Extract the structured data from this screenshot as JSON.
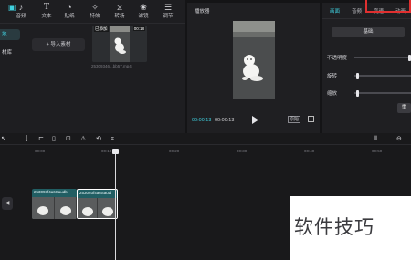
{
  "toolbar": {
    "items": [
      {
        "label": "",
        "icon": "media-icon",
        "active": true
      },
      {
        "label": "音频",
        "icon": "audio-icon"
      },
      {
        "label": "文本",
        "icon": "text-icon"
      },
      {
        "label": "贴纸",
        "icon": "sticker-icon"
      },
      {
        "label": "特效",
        "icon": "effects-icon"
      },
      {
        "label": "转场",
        "icon": "transition-icon"
      },
      {
        "label": "滤镜",
        "icon": "filter-icon"
      },
      {
        "label": "调节",
        "icon": "adjust-icon"
      }
    ]
  },
  "media_side": {
    "item1": "地",
    "item2": "材库"
  },
  "media": {
    "import_label": "导入素材",
    "clip": {
      "badge_left": "已添加",
      "badge_right": "00:18",
      "filename": "25309346...bb57.mp4"
    }
  },
  "player": {
    "title": "播放器",
    "time_current": "00:00:13",
    "time_total": "00:00:13",
    "ratio_label": "原始"
  },
  "props": {
    "tabs": [
      "画面",
      "音频",
      "变速",
      "动画"
    ],
    "basic_tab": "基础",
    "labels": {
      "opacity": "不透明度",
      "rotate": "旋转",
      "scale": "缩放"
    },
    "apply": "重",
    "values": {
      "opacity": 1.0,
      "rotate": 0.05,
      "scale": 0.05
    }
  },
  "timeline": {
    "ticks": [
      "00:00",
      "00:10",
      "00:20",
      "00:30",
      "00:40",
      "00:50"
    ],
    "clips": [
      {
        "name": "253093f4a6Saudb"
      },
      {
        "name": "253093f4a6Saud"
      }
    ]
  },
  "watermark": "软件技巧",
  "colors": {
    "accent": "#3fd0df",
    "highlight_box": "#e03030"
  }
}
